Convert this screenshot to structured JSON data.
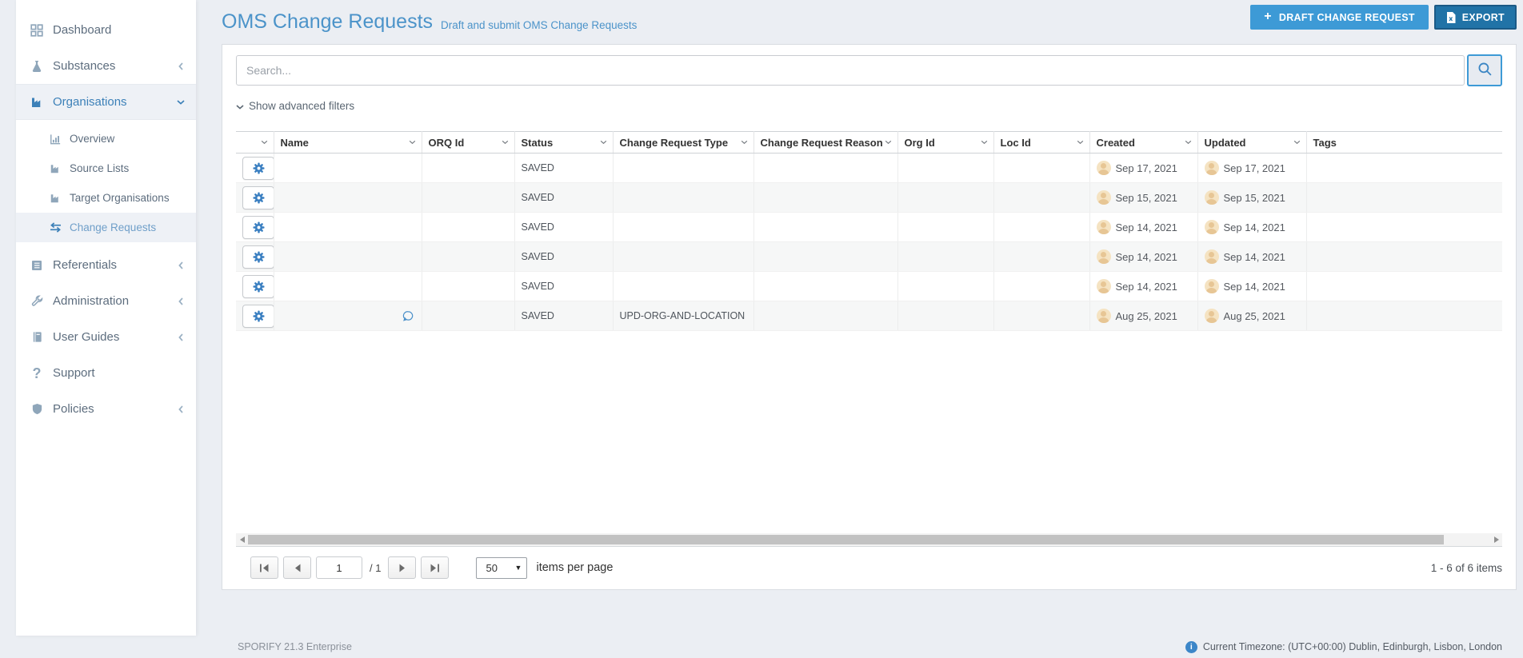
{
  "colors": {
    "accent_blue": "#3d9ad6",
    "export_blue": "#2173a7",
    "title_blue": "#4b93c9",
    "sidebar_active_blue": "#3c80b8",
    "avatar_tan": "#e7c695",
    "page_bg": "#ebeef3"
  },
  "sidebar": {
    "items": [
      {
        "label": "Dashboard"
      },
      {
        "label": "Substances"
      },
      {
        "label": "Organisations"
      },
      {
        "label": "Referentials"
      },
      {
        "label": "Administration"
      },
      {
        "label": "User Guides"
      },
      {
        "label": "Support"
      },
      {
        "label": "Policies"
      }
    ],
    "organisations_children": [
      {
        "label": "Overview"
      },
      {
        "label": "Source Lists"
      },
      {
        "label": "Target Organisations"
      },
      {
        "label": "Change Requests"
      }
    ]
  },
  "header": {
    "title": "OMS Change Requests",
    "subtitle": "Draft and submit OMS Change Requests",
    "draft_button": "DRAFT CHANGE REQUEST",
    "export_button": "EXPORT"
  },
  "search": {
    "placeholder": "Search...",
    "advanced_filters_label": "Show advanced filters"
  },
  "table": {
    "columns": [
      "Name",
      "ORQ Id",
      "Status",
      "Change Request Type",
      "Change Request Reason",
      "Org Id",
      "Loc Id",
      "Created",
      "Updated",
      "Tags"
    ],
    "rows": [
      {
        "name": "",
        "orq_id": "",
        "status": "SAVED",
        "type": "",
        "reason": "",
        "org_id": "",
        "loc_id": "",
        "created": "Sep 17, 2021",
        "updated": "Sep 17, 2021",
        "tags": ""
      },
      {
        "name": "",
        "orq_id": "",
        "status": "SAVED",
        "type": "",
        "reason": "",
        "org_id": "",
        "loc_id": "",
        "created": "Sep 15, 2021",
        "updated": "Sep 15, 2021",
        "tags": ""
      },
      {
        "name": "",
        "orq_id": "",
        "status": "SAVED",
        "type": "",
        "reason": "",
        "org_id": "",
        "loc_id": "",
        "created": "Sep 14, 2021",
        "updated": "Sep 14, 2021",
        "tags": ""
      },
      {
        "name": "",
        "orq_id": "",
        "status": "SAVED",
        "type": "",
        "reason": "",
        "org_id": "",
        "loc_id": "",
        "created": "Sep 14, 2021",
        "updated": "Sep 14, 2021",
        "tags": ""
      },
      {
        "name": "",
        "orq_id": "",
        "status": "SAVED",
        "type": "",
        "reason": "",
        "org_id": "",
        "loc_id": "",
        "created": "Sep 14, 2021",
        "updated": "Sep 14, 2021",
        "tags": ""
      },
      {
        "name": "",
        "orq_id": "",
        "status": "SAVED",
        "type": "UPD-ORG-AND-LOCATION",
        "reason": "",
        "org_id": "",
        "loc_id": "",
        "created": "Aug 25, 2021",
        "updated": "Aug 25, 2021",
        "tags": ""
      }
    ]
  },
  "pagination": {
    "page": "1",
    "page_count_label": "/ 1",
    "page_size": "50",
    "items_per_page_label": "items per page",
    "range_label": "1 - 6 of 6 items"
  },
  "footer": {
    "left": "SPORIFY 21.3 Enterprise",
    "right": "Current Timezone: (UTC+00:00) Dublin, Edinburgh, Lisbon, London"
  }
}
